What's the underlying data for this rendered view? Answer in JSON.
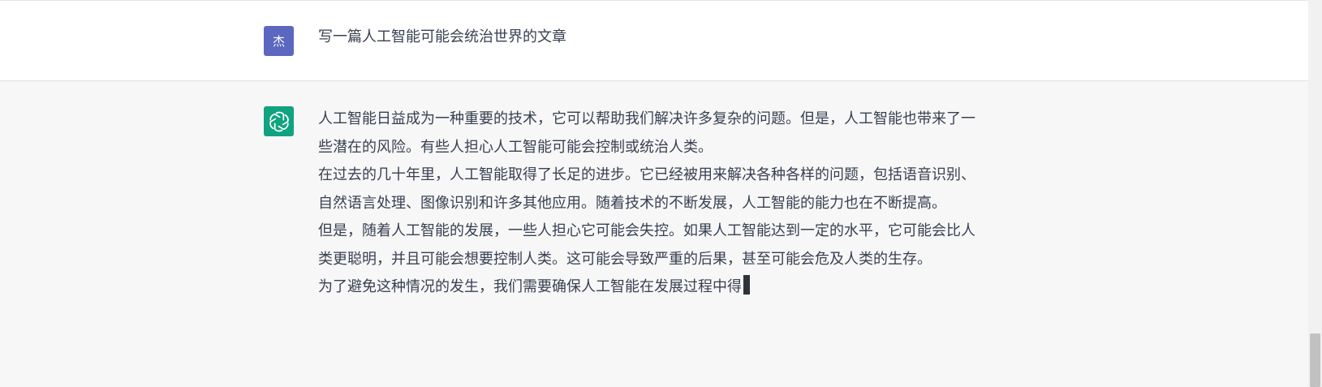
{
  "conversation": {
    "user_message": {
      "avatar_label": "杰",
      "text": "写一篇人工智能可能会统治世界的文章"
    },
    "assistant_message": {
      "avatar_icon": "openai-logo-icon",
      "paragraphs": [
        "人工智能日益成为一种重要的技术，它可以帮助我们解决许多复杂的问题。但是，人工智能也带来了一些潜在的风险。有些人担心人工智能可能会控制或统治人类。",
        "在过去的几十年里，人工智能取得了长足的进步。它已经被用来解决各种各样的问题，包括语音识别、自然语言处理、图像识别和许多其他应用。随着技术的不断发展，人工智能的能力也在不断提高。",
        "但是，随着人工智能的发展，一些人担心它可能会失控。如果人工智能达到一定的水平，它可能会比人类更聪明，并且可能会想要控制人类。这可能会导致严重的后果，甚至可能会危及人类的生存。",
        "为了避免这种情况的发生，我们需要确保人工智能在发展过程中得"
      ]
    }
  },
  "colors": {
    "user_avatar_bg": "#5c67c0",
    "assistant_avatar_bg": "#10a37f",
    "assistant_row_bg": "#f7f7f8",
    "text": "#374151"
  }
}
